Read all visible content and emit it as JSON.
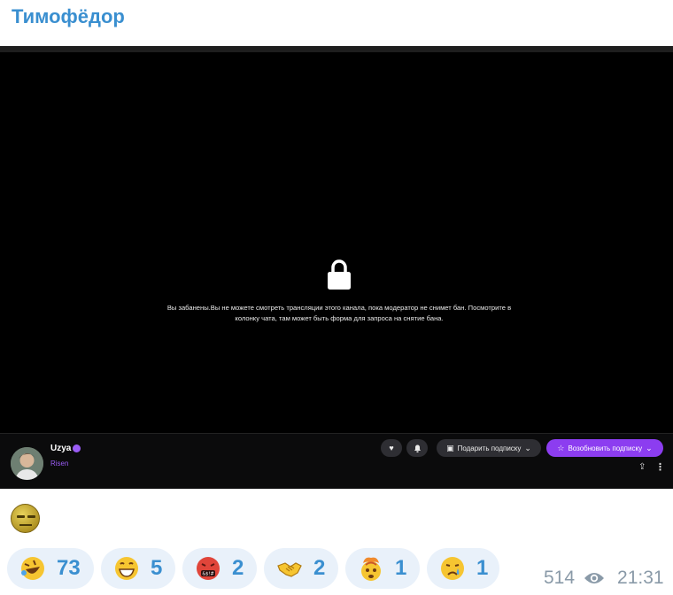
{
  "message": {
    "author": "Тимофёдор",
    "views": "514",
    "time": "21:31",
    "caption_emoji": "grimace-face"
  },
  "screenshot": {
    "ban_message": "Вы забанены.Вы не можете смотреть трансляции этого канала, пока модератор не снимет бан. Посмотрите в колонку чата, там может быть форма для запроса на снятие бана.",
    "streamer": {
      "name": "Uzya",
      "game": "Risen"
    },
    "buttons": {
      "gift_sub": "Подарить подписку",
      "resub": "Возобновить подписку"
    },
    "accent_color": "#8c3df0"
  },
  "reactions": [
    {
      "emoji": "rolling-on-floor-laughing",
      "count": "73"
    },
    {
      "emoji": "grinning-face",
      "count": "5"
    },
    {
      "emoji": "face-with-symbols-on-mouth",
      "count": "2"
    },
    {
      "emoji": "handshake",
      "count": "2"
    },
    {
      "emoji": "exploding-head",
      "count": "1"
    },
    {
      "emoji": "crying-face",
      "count": "1"
    }
  ]
}
